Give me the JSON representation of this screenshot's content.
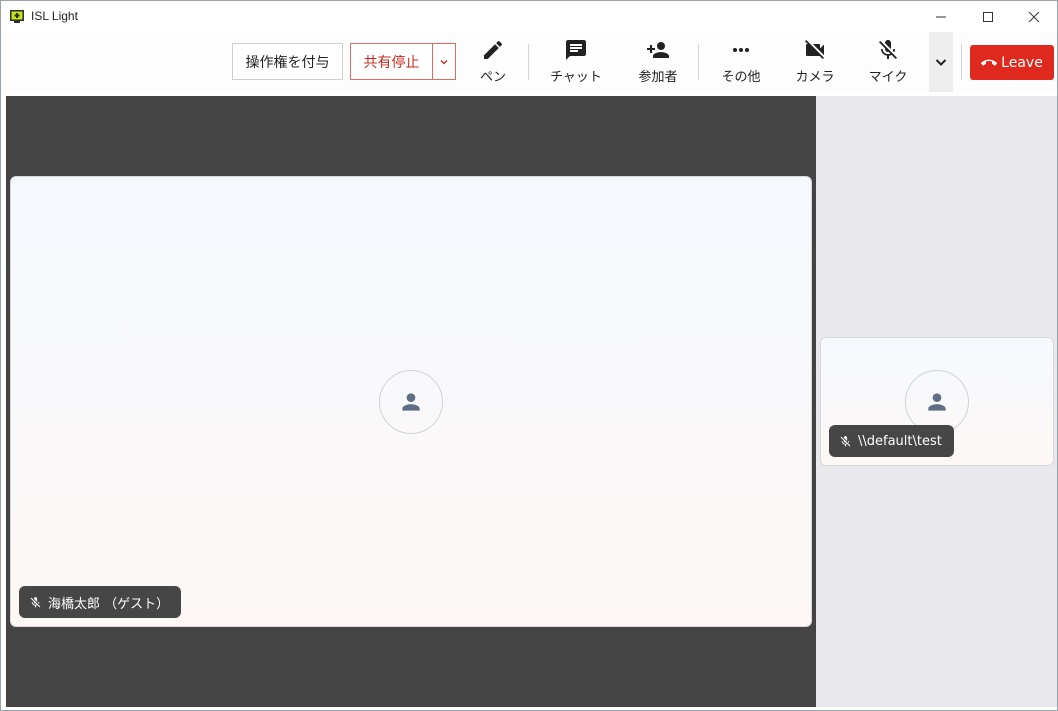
{
  "window": {
    "title": "ISL Light"
  },
  "toolbar": {
    "give_control_label": "操作権を付与",
    "stop_share_label": "共有停止",
    "pen_label": "ペン",
    "chat_label": "チャット",
    "participants_label": "参加者",
    "more_label": "その他",
    "camera_label": "カメラ",
    "mic_label": "マイク",
    "leave_label": "Leave"
  },
  "participants": {
    "main": {
      "name": "海橋太郎 （ゲスト）"
    },
    "side": {
      "name": "\\\\default\\test"
    }
  },
  "colors": {
    "leave": "#e0291e",
    "stop_share": "#c72b20",
    "stage_bg": "#444444",
    "side_bg": "#e9e8ed",
    "chip_bg": "#464646",
    "avatar_icon": "#5f6e84"
  }
}
